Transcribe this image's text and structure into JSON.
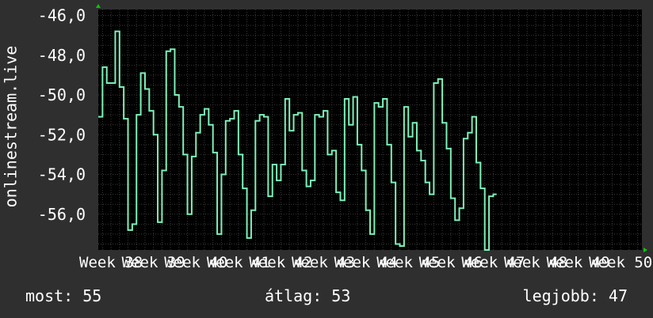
{
  "chart_data": {
    "type": "line",
    "ylabel": "onlinestream.live",
    "y_ticks": [
      "-46,0",
      "-48,0",
      "-50,0",
      "-52,0",
      "-54,0",
      "-56,0"
    ],
    "y_tick_values": [
      -46,
      -48,
      -50,
      -52,
      -54,
      -56
    ],
    "ylim": [
      -57.8,
      -45.7
    ],
    "x_ticks": [
      "Week 38",
      "Week 39",
      "Week 40",
      "Week 41",
      "Week 42",
      "Week 43",
      "Week 44",
      "Week 45",
      "Week 46",
      "Week 47",
      "Week 48",
      "Week 49",
      "Week 50"
    ],
    "xlim": [
      37.7,
      50.5
    ],
    "grid": true,
    "colors": {
      "background": "#000000",
      "line": "#7ef0b8",
      "grid": "#3a3a3a",
      "axis_arrow": "#00cc00"
    },
    "series": [
      {
        "values": [
          [
            37.7,
            -51.1
          ],
          [
            37.8,
            -48.6
          ],
          [
            37.9,
            -49.4
          ],
          [
            38.0,
            -49.4
          ],
          [
            38.1,
            -46.8
          ],
          [
            38.2,
            -49.6
          ],
          [
            38.3,
            -51.2
          ],
          [
            38.4,
            -56.8
          ],
          [
            38.5,
            -56.5
          ],
          [
            38.6,
            -51.0
          ],
          [
            38.7,
            -48.9
          ],
          [
            38.8,
            -49.7
          ],
          [
            38.9,
            -50.8
          ],
          [
            39.0,
            -52.0
          ],
          [
            39.1,
            -56.4
          ],
          [
            39.2,
            -53.8
          ],
          [
            39.3,
            -47.8
          ],
          [
            39.4,
            -47.7
          ],
          [
            39.5,
            -50.0
          ],
          [
            39.6,
            -50.6
          ],
          [
            39.7,
            -53.0
          ],
          [
            39.8,
            -56.0
          ],
          [
            39.9,
            -53.1
          ],
          [
            40.0,
            -51.9
          ],
          [
            40.1,
            -51.0
          ],
          [
            40.2,
            -50.7
          ],
          [
            40.3,
            -51.5
          ],
          [
            40.4,
            -52.9
          ],
          [
            40.5,
            -57.0
          ],
          [
            40.6,
            -54.0
          ],
          [
            40.7,
            -51.3
          ],
          [
            40.8,
            -51.2
          ],
          [
            40.9,
            -50.8
          ],
          [
            41.0,
            -53.0
          ],
          [
            41.1,
            -54.7
          ],
          [
            41.2,
            -57.2
          ],
          [
            41.3,
            -55.8
          ],
          [
            41.4,
            -51.3
          ],
          [
            41.5,
            -51.0
          ],
          [
            41.6,
            -51.1
          ],
          [
            41.7,
            -55.1
          ],
          [
            41.8,
            -53.5
          ],
          [
            41.9,
            -54.3
          ],
          [
            42.0,
            -53.5
          ],
          [
            42.1,
            -50.2
          ],
          [
            42.2,
            -51.8
          ],
          [
            42.3,
            -51.0
          ],
          [
            42.4,
            -50.9
          ],
          [
            42.5,
            -53.8
          ],
          [
            42.6,
            -54.6
          ],
          [
            42.7,
            -54.3
          ],
          [
            42.8,
            -51.0
          ],
          [
            42.9,
            -51.1
          ],
          [
            43.0,
            -50.8
          ],
          [
            43.1,
            -53.0
          ],
          [
            43.2,
            -52.8
          ],
          [
            43.3,
            -54.9
          ],
          [
            43.4,
            -55.3
          ],
          [
            43.5,
            -50.2
          ],
          [
            43.6,
            -51.5
          ],
          [
            43.7,
            -50.1
          ],
          [
            43.8,
            -52.5
          ],
          [
            43.9,
            -53.8
          ],
          [
            44.0,
            -55.8
          ],
          [
            44.1,
            -57.0
          ],
          [
            44.2,
            -50.4
          ],
          [
            44.3,
            -50.6
          ],
          [
            44.4,
            -50.2
          ],
          [
            44.5,
            -52.5
          ],
          [
            44.6,
            -54.4
          ],
          [
            44.7,
            -57.5
          ],
          [
            44.8,
            -57.6
          ],
          [
            44.9,
            -50.6
          ],
          [
            45.0,
            -52.1
          ],
          [
            45.1,
            -51.4
          ],
          [
            45.2,
            -52.8
          ],
          [
            45.3,
            -53.3
          ],
          [
            45.4,
            -54.4
          ],
          [
            45.5,
            -55.0
          ],
          [
            45.6,
            -49.4
          ],
          [
            45.7,
            -49.2
          ],
          [
            45.8,
            -51.4
          ],
          [
            45.9,
            -52.7
          ],
          [
            46.0,
            -55.2
          ],
          [
            46.1,
            -56.3
          ],
          [
            46.2,
            -55.7
          ],
          [
            46.3,
            -52.2
          ],
          [
            46.4,
            -51.9
          ],
          [
            46.5,
            -51.1
          ],
          [
            46.6,
            -53.4
          ],
          [
            46.7,
            -54.7
          ],
          [
            46.8,
            -57.8
          ],
          [
            46.9,
            -55.1
          ],
          [
            47.0,
            -55.0
          ]
        ]
      }
    ]
  },
  "footer": {
    "now": "most: 55",
    "avg": "átlag: 53",
    "best": "legjobb: 47"
  }
}
